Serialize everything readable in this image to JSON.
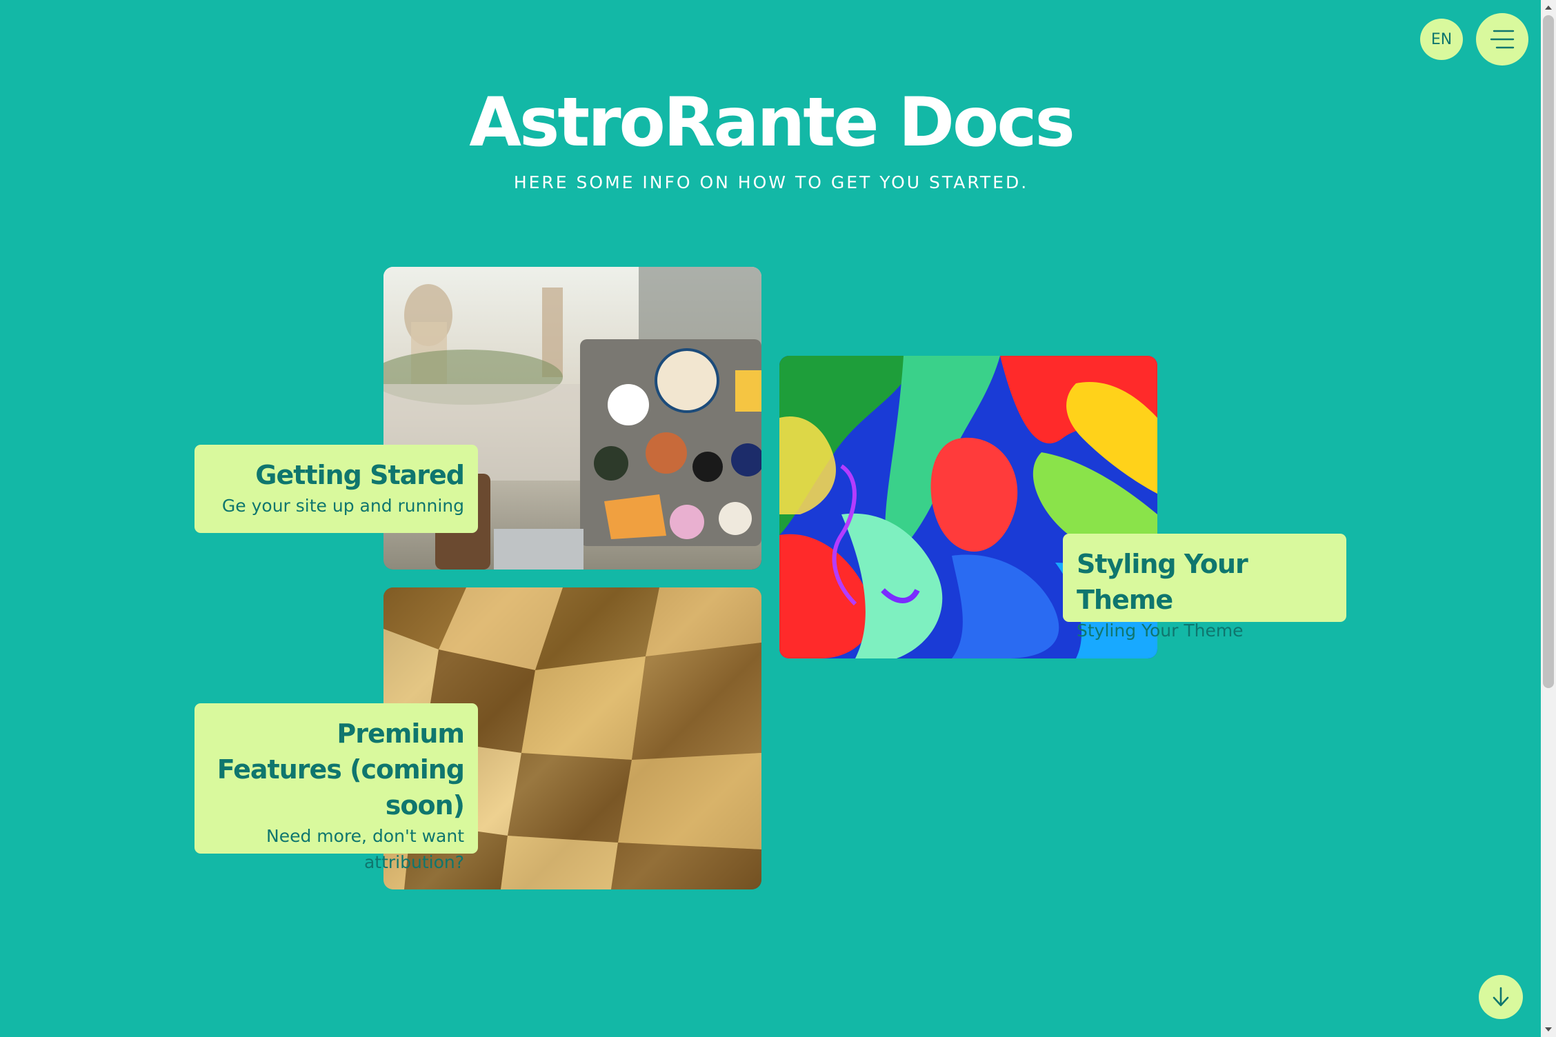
{
  "header": {
    "language_label": "EN",
    "menu_icon": "hamburger-menu-icon"
  },
  "hero": {
    "title": "AstroRante Docs",
    "subtitle": "HERE SOME INFO ON HOW TO GET YOU STARTED."
  },
  "cards": [
    {
      "title": "Getting Stared",
      "description": "Ge your site up and running",
      "image": "laptop-stickers-photo"
    },
    {
      "title": "Styling Your Theme",
      "description": "Styling Your Theme",
      "image": "colorful-paint-photo"
    },
    {
      "title": "Premium Features (coming soon)",
      "description": "Need more, don't want attribution?",
      "image": "gold-foil-photo"
    }
  ],
  "footer": {
    "scroll_down_icon": "arrow-down-icon"
  },
  "colors": {
    "background": "#13b8a6",
    "accent": "#d9f99d",
    "accent_text": "#0f766e",
    "hero_text": "#ffffff"
  }
}
